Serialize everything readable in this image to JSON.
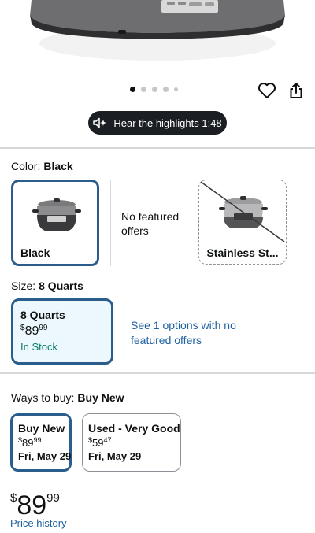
{
  "gallery": {
    "dots_total": 5,
    "active_dot": 0
  },
  "audio": {
    "label": "Hear the highlights 1:48"
  },
  "color_row": {
    "label": "Color:",
    "selected": "Black",
    "options": [
      {
        "name": "Black",
        "selected": true
      },
      {
        "name": "Stainless St...",
        "selected": false,
        "unavailable": true
      }
    ],
    "no_featured": "No featured offers"
  },
  "size_row": {
    "label": "Size:",
    "selected": "8 Quarts",
    "option": {
      "name": "8 Quarts",
      "currency": "$",
      "whole": "89",
      "fraction": "99",
      "stock": "In Stock"
    },
    "see_link": "See 1 options with no featured offers"
  },
  "ways_to_buy": {
    "label": "Ways to buy:",
    "selected": "Buy New",
    "options": [
      {
        "title": "Buy New",
        "currency": "$",
        "whole": "89",
        "fraction": "99",
        "date": "Fri, May 29"
      },
      {
        "title": "Used - Very Good",
        "currency": "$",
        "whole": "59",
        "fraction": "47",
        "date": "Fri, May 29"
      }
    ]
  },
  "price": {
    "currency": "$",
    "whole": "89",
    "fraction": "99"
  },
  "price_history": "Price history",
  "colors": {
    "selected_border": "#2b5d8c",
    "link": "#2162a1",
    "in_stock": "#067d62",
    "selected_bg": "#ecf8fd"
  }
}
